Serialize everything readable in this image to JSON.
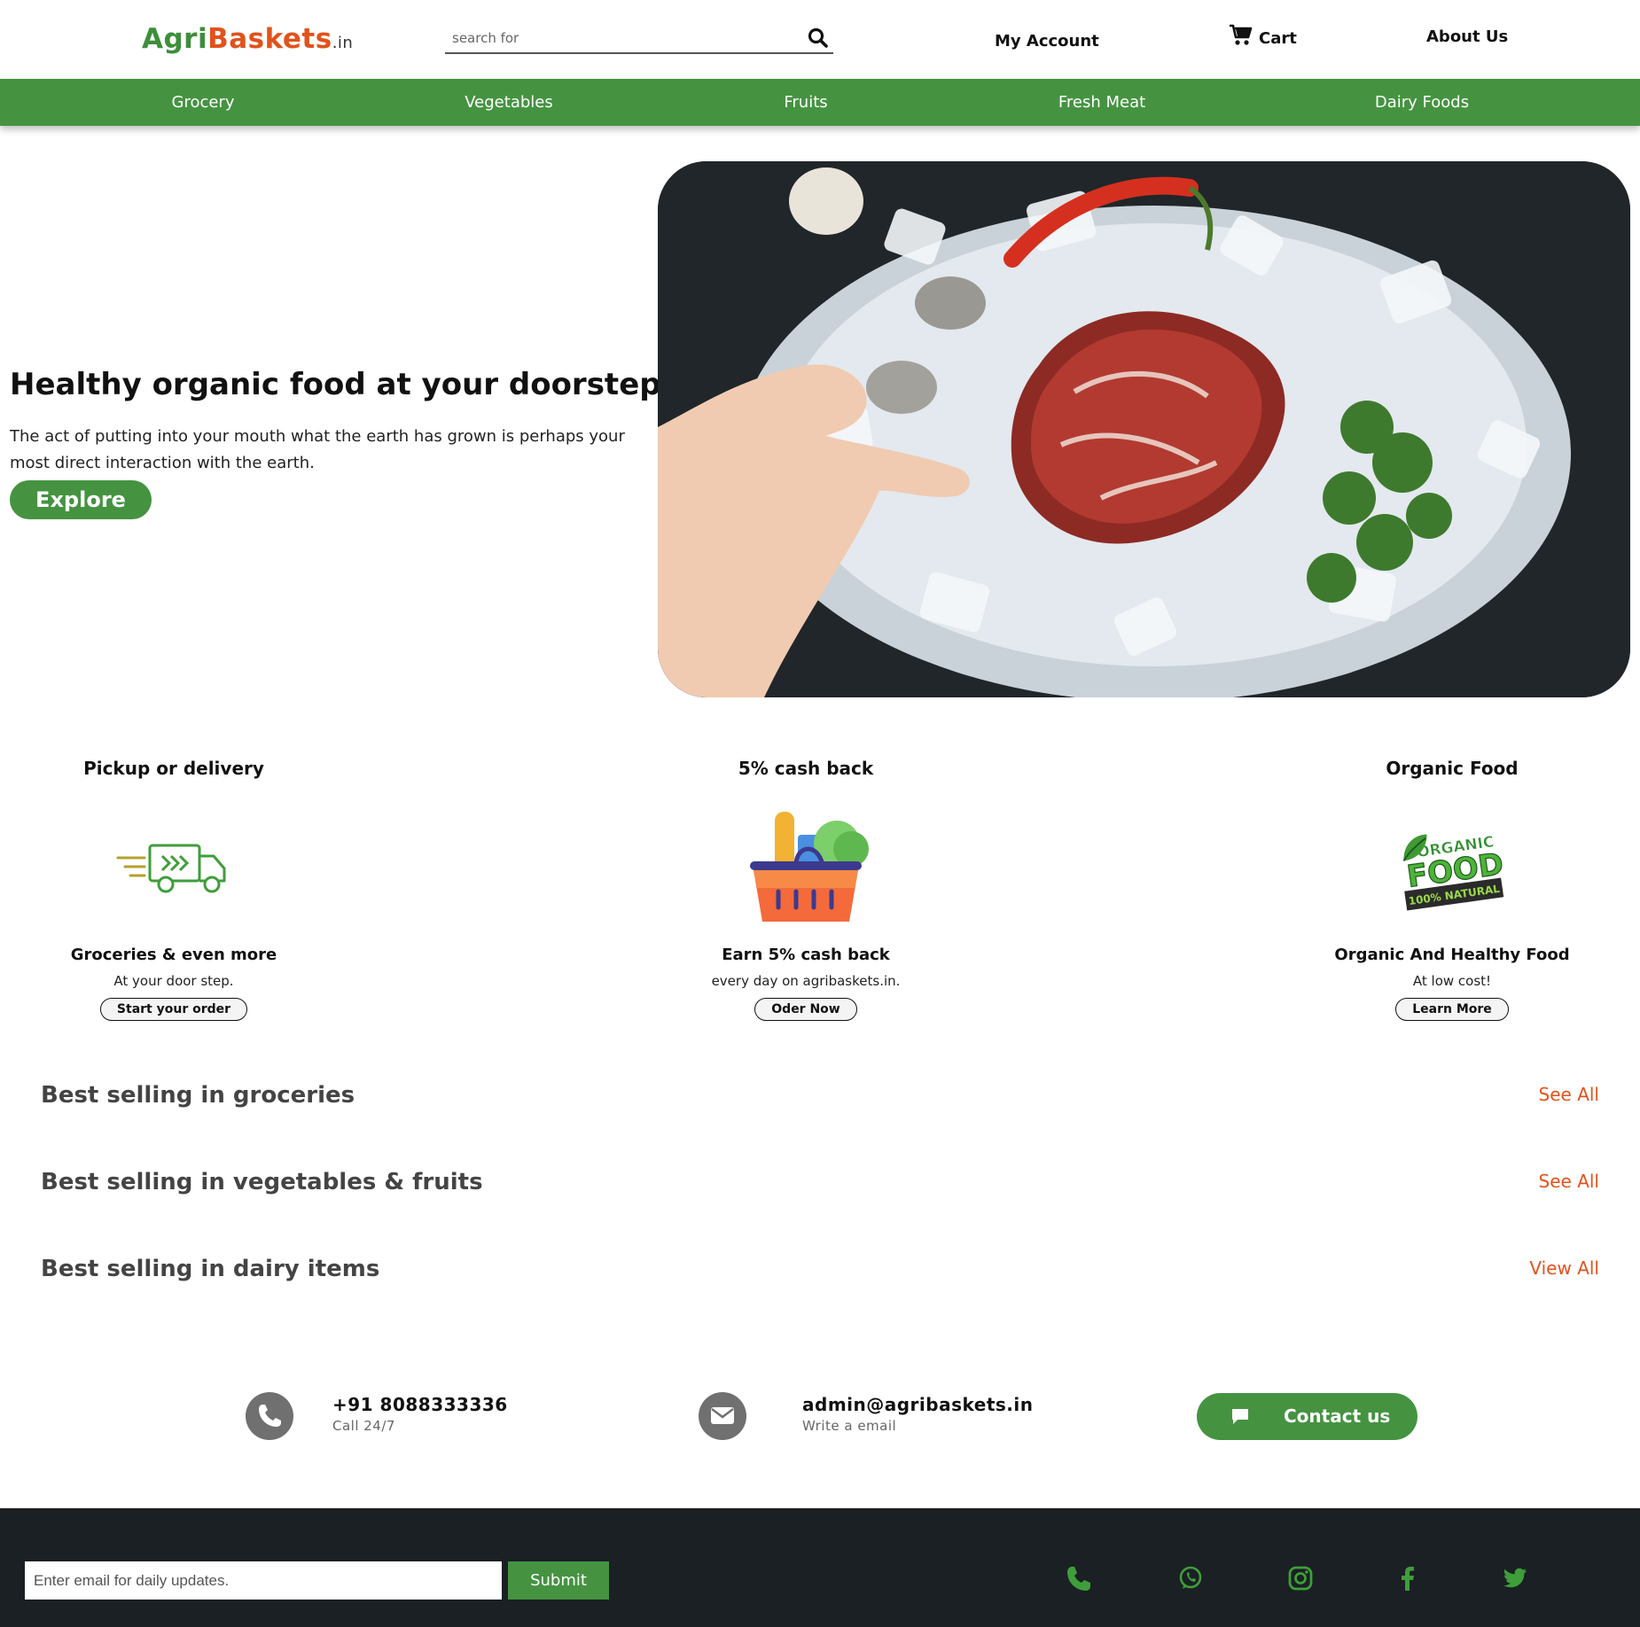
{
  "header": {
    "logo": {
      "part1": "Agri",
      "part2": "Baskets",
      "part3": ".in"
    },
    "search_placeholder": "search for",
    "my_account": "My Account",
    "cart": "Cart",
    "about": "About Us"
  },
  "categories": [
    "Grocery",
    "Vegetables",
    "Fruits",
    "Fresh Meat",
    "Dairy Foods"
  ],
  "hero": {
    "title": "Healthy organic food at your doorstep.",
    "text": "The act of putting into your mouth what the earth has grown is perhaps your most direct interaction with the earth.",
    "button": "Explore"
  },
  "features": [
    {
      "title": "Pickup or delivery",
      "icon": "delivery-truck-icon",
      "subtitle": "Groceries & even more",
      "text": "At your door step.",
      "button": "Start your order"
    },
    {
      "title": "5% cash back",
      "icon": "grocery-basket-icon",
      "subtitle": "Earn 5% cash back",
      "text": "every day on agribaskets.in.",
      "button": "Oder Now"
    },
    {
      "title": "Organic Food",
      "icon": "organic-food-badge",
      "subtitle": "Organic And Healthy Food",
      "text": "At low cost!",
      "button": "Learn More"
    }
  ],
  "organic_badge": {
    "line1": "ORGANIC",
    "line2": "FOOD",
    "line3": "100% NATURAL"
  },
  "sections": [
    {
      "title": "Best selling in groceries",
      "link": "See All"
    },
    {
      "title": "Best selling in vegetables & fruits",
      "link": "See All"
    },
    {
      "title": "Best selling in dairy items",
      "link": "View All"
    }
  ],
  "contact": {
    "phone": "+91 8088333336",
    "phone_sub": "Call 24/7",
    "email": "admin@agribaskets.in",
    "email_sub": "Write a email",
    "button": "Contact us"
  },
  "footer": {
    "email_placeholder": "Enter email for daily updates.",
    "submit": "Submit",
    "social_icons": [
      "phone-icon",
      "whatsapp-icon",
      "instagram-icon",
      "facebook-icon",
      "twitter-icon"
    ]
  },
  "colors": {
    "brand_green": "#459341",
    "brand_orange": "#e0531c",
    "footer_bg": "#1b2024"
  }
}
